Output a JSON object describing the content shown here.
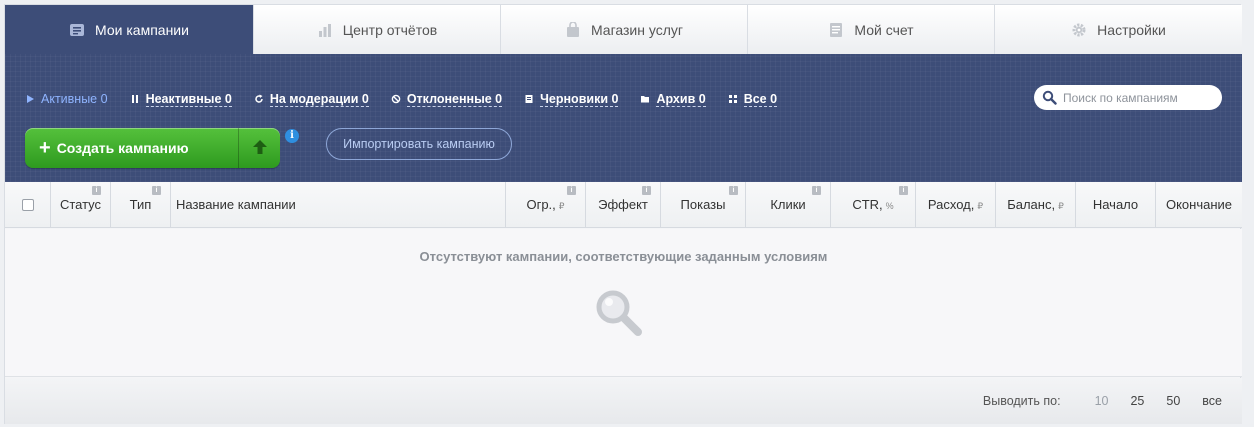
{
  "tabs": [
    {
      "label": "Мои кампании",
      "icon": "campaigns-icon",
      "active": true
    },
    {
      "label": "Центр отчётов",
      "icon": "reports-icon"
    },
    {
      "label": "Магазин услуг",
      "icon": "shop-icon"
    },
    {
      "label": "Мой счет",
      "icon": "account-icon"
    },
    {
      "label": "Настройки",
      "icon": "settings-icon"
    }
  ],
  "filters": [
    {
      "label": "Активные 0",
      "icon": "play-icon",
      "active": true
    },
    {
      "label": "Неактивные 0",
      "icon": "pause-icon"
    },
    {
      "label": "На модерации 0",
      "icon": "refresh-icon"
    },
    {
      "label": "Отклоненные 0",
      "icon": "blocked-icon"
    },
    {
      "label": "Черновики 0",
      "icon": "draft-icon"
    },
    {
      "label": "Архив 0",
      "icon": "folder-icon"
    },
    {
      "label": "Все 0",
      "icon": "grid-icon"
    }
  ],
  "search": {
    "placeholder": "Поиск по кампаниям"
  },
  "actions": {
    "create_label": "Создать кампанию",
    "import_label": "Импортировать кампанию",
    "info_glyph": "i"
  },
  "table": {
    "columns": [
      {
        "label": "Статус"
      },
      {
        "label": "Тип"
      },
      {
        "label": "Название кампании"
      },
      {
        "label": "Огр.,",
        "unit": "₽"
      },
      {
        "label": "Эффект"
      },
      {
        "label": "Показы"
      },
      {
        "label": "Клики"
      },
      {
        "label": "CTR,",
        "unit": "%"
      },
      {
        "label": "Расход,",
        "unit": "₽"
      },
      {
        "label": "Баланс,",
        "unit": "₽"
      },
      {
        "label": "Начало"
      },
      {
        "label": "Окончание"
      }
    ],
    "empty_message": "Отсутствуют кампании, соответствующие заданным условиям"
  },
  "pagination": {
    "label": "Выводить по:",
    "options": [
      "10",
      "25",
      "50",
      "все"
    ],
    "current": "10"
  },
  "colors": {
    "band": "#3d4d78",
    "create": "#3aa828",
    "link_active": "#8fb4ff"
  }
}
